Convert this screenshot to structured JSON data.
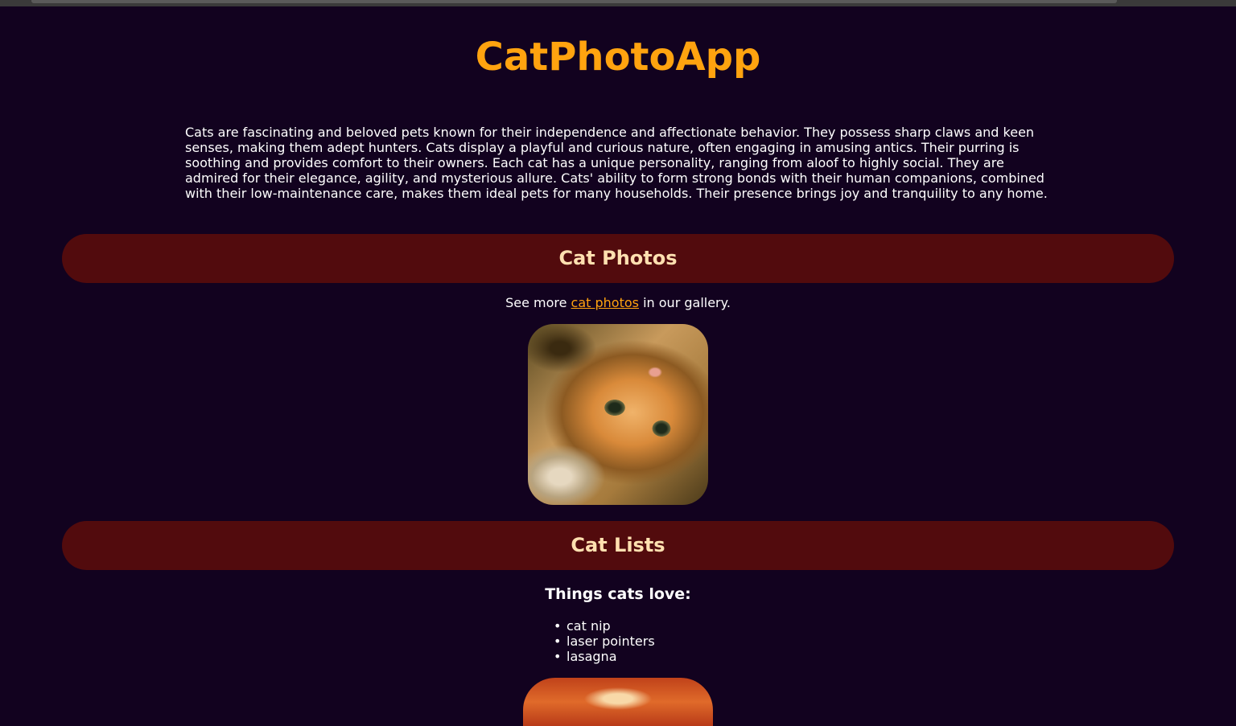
{
  "app": {
    "title": "CatPhotoApp",
    "intro": "Cats are fascinating and beloved pets known for their independence and affectionate behavior. They possess sharp claws and keen senses, making them adept hunters. Cats display a playful and curious nature, often engaging in amusing antics. Their purring is soothing and provides comfort to their owners. Each cat has a unique personality, ranging from aloof to highly social. They are admired for their elegance, agility, and mysterious allure. Cats' ability to form strong bonds with their human companions, combined with their low-maintenance care, makes them ideal pets for many households. Their presence brings joy and tranquility to any home."
  },
  "photos_section": {
    "heading": "Cat Photos",
    "see_more_prefix": "See more ",
    "link_text": "cat photos",
    "see_more_suffix": " in our gallery."
  },
  "lists_section": {
    "heading": "Cat Lists",
    "subheading": "Things cats love:",
    "items": [
      "cat nip",
      "laser pointers",
      "lasagna"
    ]
  },
  "colors": {
    "background": "#12021f",
    "accent": "#ffa30f",
    "section_bar": "#520b0d",
    "section_text": "#ffe0b0"
  }
}
